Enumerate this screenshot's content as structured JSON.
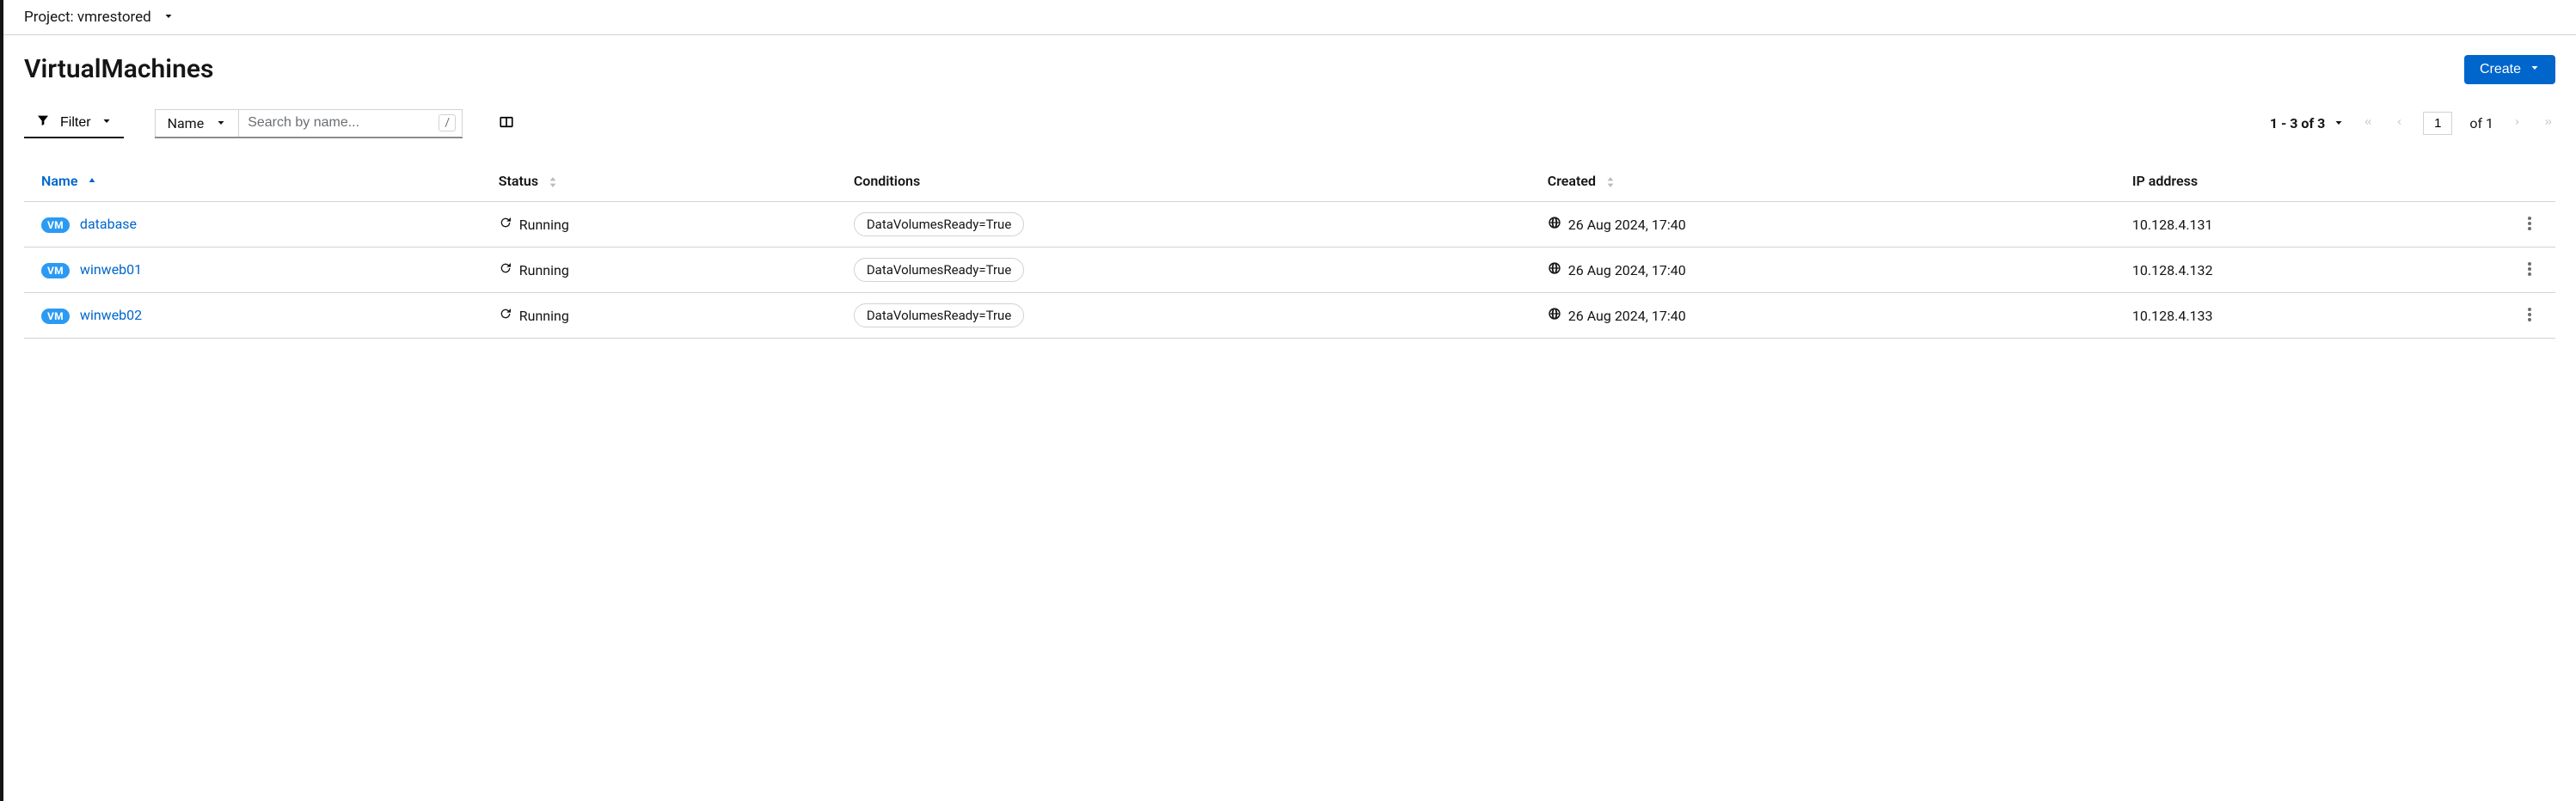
{
  "project": {
    "label": "Project:",
    "name": "vmrestored"
  },
  "page_title": "VirtualMachines",
  "create_button": {
    "label": "Create"
  },
  "toolbar": {
    "filter_label": "Filter",
    "search_scope_label": "Name",
    "search_placeholder": "Search by name...",
    "search_hint": "/"
  },
  "pagination": {
    "range_text": "1 - 3 of 3",
    "page_value": "1",
    "of_label": "of 1"
  },
  "columns": {
    "name": "Name",
    "status": "Status",
    "conditions": "Conditions",
    "created": "Created",
    "ip": "IP address"
  },
  "badge": "VM",
  "rows": [
    {
      "name": "database",
      "status": "Running",
      "condition": "DataVolumesReady=True",
      "created": "26 Aug 2024, 17:40",
      "ip": "10.128.4.131"
    },
    {
      "name": "winweb01",
      "status": "Running",
      "condition": "DataVolumesReady=True",
      "created": "26 Aug 2024, 17:40",
      "ip": "10.128.4.132"
    },
    {
      "name": "winweb02",
      "status": "Running",
      "condition": "DataVolumesReady=True",
      "created": "26 Aug 2024, 17:40",
      "ip": "10.128.4.133"
    }
  ]
}
